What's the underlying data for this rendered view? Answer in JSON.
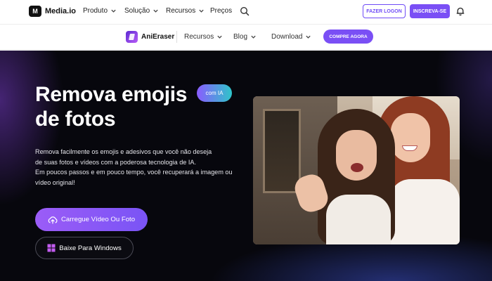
{
  "topnav": {
    "brand": "Media.io",
    "brand_logo": "M",
    "items": [
      {
        "label": "Produto",
        "dropdown": true
      },
      {
        "label": "Solução",
        "dropdown": true
      },
      {
        "label": "Recursos",
        "dropdown": true
      },
      {
        "label": "Preços",
        "dropdown": false
      }
    ],
    "login_label": "FAZER LOGON",
    "signup_label": "INSCREVA-SE"
  },
  "subnav": {
    "brand": "AniEraser",
    "items": [
      {
        "label": "Recursos"
      },
      {
        "label": "Blog"
      },
      {
        "label": "Download"
      }
    ],
    "buy_label": "COMPRE AGORA"
  },
  "hero": {
    "title_line1": "Remova emojis",
    "title_line2": "de fotos",
    "badge": "com IA",
    "description": [
      "Remova facilmente os emojis e adesivos que você não deseja",
      "de suas fotos e vídeos com a poderosa tecnologia de IA.",
      "Em poucos passos e em pouco tempo, você recuperará a imagem ou",
      "vídeo original!"
    ],
    "upload_label": "Carregue Vídeo Ou Foto",
    "windows_label": "Baixe Para Windows"
  },
  "colors": {
    "accent": "#7a4ff5",
    "hero_bg": "#07070d",
    "badge_gradient_start": "#8a5cff",
    "badge_gradient_end": "#2ec5c9"
  },
  "icons": [
    "media-io-logo",
    "chevron-down-icon",
    "search-icon",
    "bell-icon",
    "anieraser-logo",
    "cloud-upload-icon",
    "windows-icon"
  ]
}
